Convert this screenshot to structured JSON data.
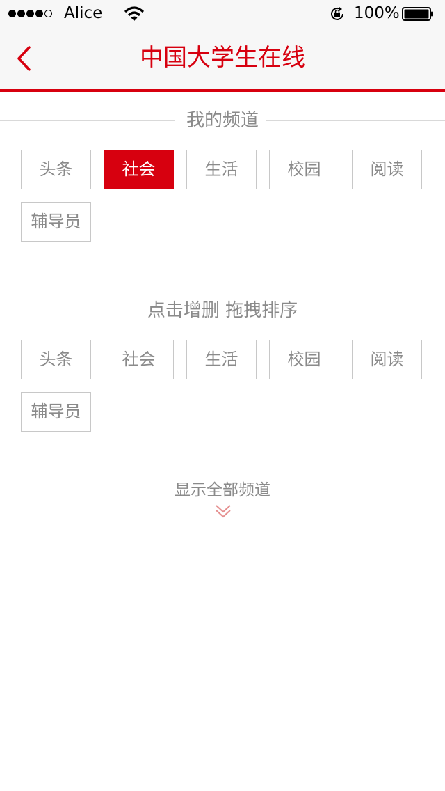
{
  "status_bar": {
    "carrier": "Alice",
    "battery": "100%"
  },
  "nav": {
    "title": "中国大学生在线"
  },
  "my_channels": {
    "heading": "我的频道",
    "items": [
      "头条",
      "社会",
      "生活",
      "校园",
      "阅读",
      "辅导员"
    ],
    "active_index": 1
  },
  "edit_channels": {
    "heading": "点击增删  拖拽排序",
    "items": [
      "头条",
      "社会",
      "生活",
      "校园",
      "阅读",
      "辅导员"
    ]
  },
  "show_all": {
    "label": "显示全部频道"
  },
  "colors": {
    "accent": "#d7000f",
    "muted_text": "#8a8a8a",
    "border": "#c8c8c8"
  }
}
